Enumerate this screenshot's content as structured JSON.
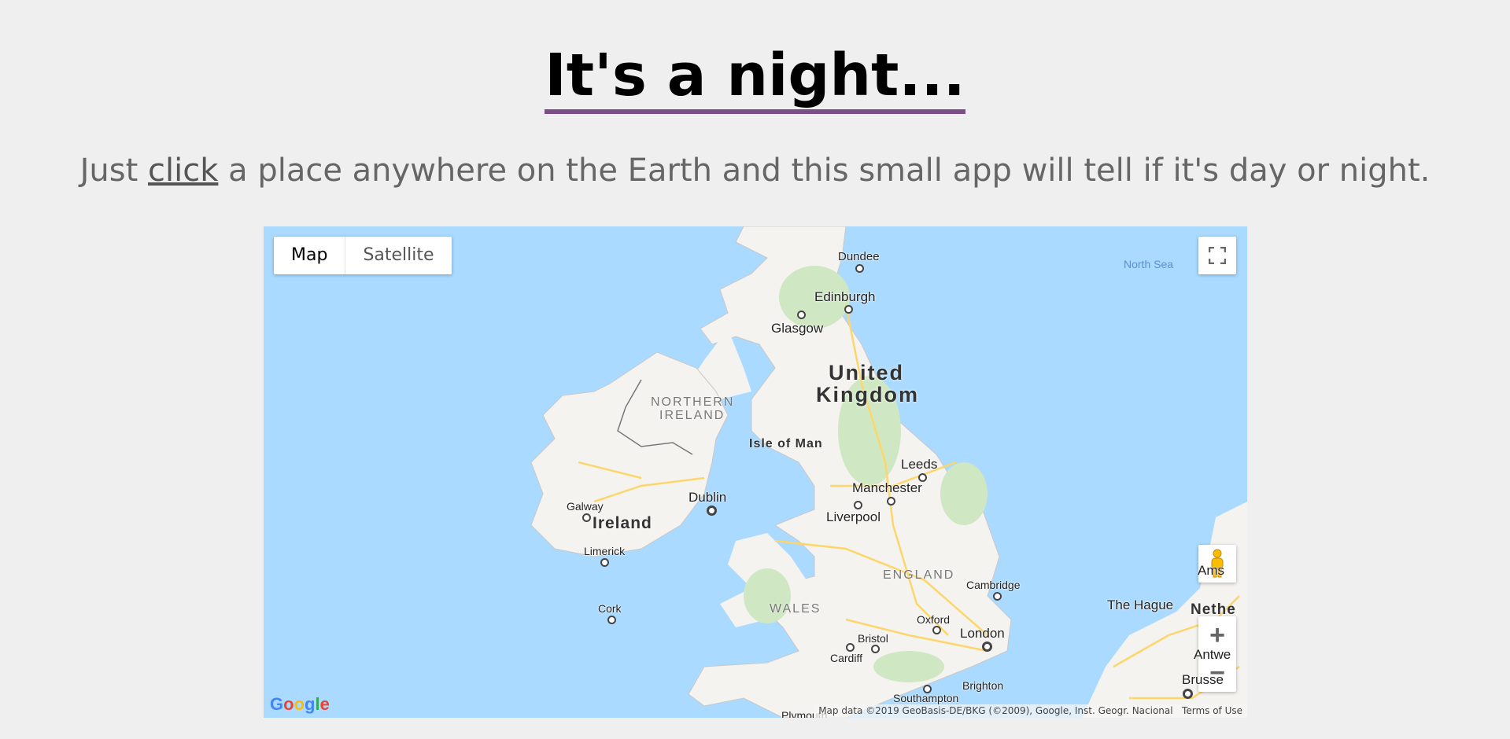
{
  "header": {
    "title": "It's a night...",
    "subtitle_before": "Just ",
    "subtitle_link": "click",
    "subtitle_after": " a place anywhere on the Earth and this small app will tell if it's day or night."
  },
  "map": {
    "type_control": {
      "map_label": "Map",
      "satellite_label": "Satellite",
      "selected": "Map"
    },
    "fullscreen_icon": "fullscreen-icon",
    "pegman_icon": "pegman-icon",
    "zoom_in_label": "+",
    "zoom_out_label": "−",
    "logo": "Google",
    "attribution": "Map data ©2019 GeoBasis-DE/BKG (©2009), Google, Inst. Geogr. Nacional",
    "terms_label": "Terms of Use",
    "labels": {
      "north_sea": "North Sea",
      "dundee": "Dundee",
      "edinburgh": "Edinburgh",
      "glasgow": "Glasgow",
      "united_kingdom_1": "United",
      "united_kingdom_2": "Kingdom",
      "northern_ireland_1": "NORTHERN",
      "northern_ireland_2": "IRELAND",
      "isle_of_man": "Isle of Man",
      "leeds": "Leeds",
      "manchester": "Manchester",
      "liverpool": "Liverpool",
      "dublin": "Dublin",
      "galway": "Galway",
      "ireland": "Ireland",
      "limerick": "Limerick",
      "cork": "Cork",
      "england": "ENGLAND",
      "cambridge": "Cambridge",
      "wales": "WALES",
      "oxford": "Oxford",
      "london": "London",
      "bristol": "Bristol",
      "cardiff": "Cardiff",
      "brighton": "Brighton",
      "southampton": "Southampton",
      "plymouth": "Plymouth",
      "the_hague": "The Hague",
      "amsterdam_partial": "Ams",
      "netherlands_partial": "Nethe",
      "antwerp_partial": "Antwe",
      "brussels_partial": "Brusse"
    },
    "colors": {
      "water": "#aadaff",
      "land": "#f5f3ef",
      "green": "#cfe8c3",
      "roads": "#fdd66b"
    }
  }
}
